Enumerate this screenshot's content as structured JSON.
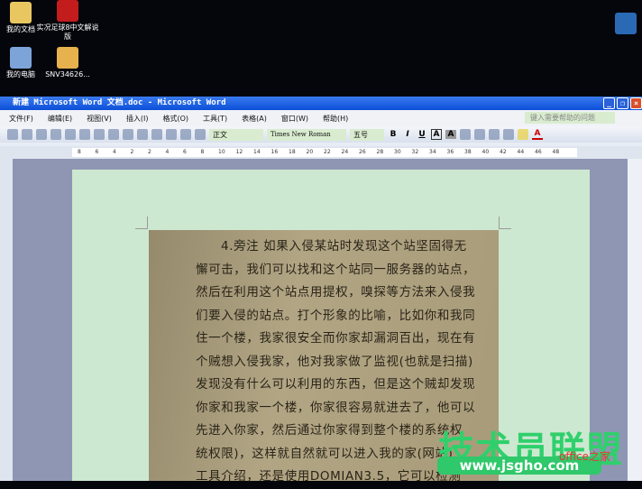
{
  "desktop": {
    "icons": [
      {
        "label": "我的文档"
      },
      {
        "label": "实况足球8中文解说版"
      },
      {
        "label": "我的电脑"
      },
      {
        "label": "SNV34626..."
      }
    ]
  },
  "window": {
    "title": "新建 Microsoft Word 文档.doc - Microsoft Word"
  },
  "menu": [
    "文件(F)",
    "编辑(E)",
    "视图(V)",
    "插入(I)",
    "格式(O)",
    "工具(T)",
    "表格(A)",
    "窗口(W)",
    "帮助(H)"
  ],
  "help_placeholder": "键入需要帮助的问题",
  "toolbar": {
    "style": "正文",
    "font": "Times New Roman",
    "size": "五号",
    "bold": "B",
    "italic": "I",
    "underline": "U",
    "charbox": "A",
    "shade": "A",
    "fontcolor": "A"
  },
  "ruler": [
    "8",
    "6",
    "4",
    "2",
    "2",
    "4",
    "6",
    "8",
    "10",
    "12",
    "14",
    "16",
    "18",
    "20",
    "22",
    "24",
    "26",
    "28",
    "30",
    "32",
    "34",
    "36",
    "38",
    "40",
    "42",
    "44",
    "46",
    "48"
  ],
  "document": {
    "lines": [
      "4.旁注 如果入侵某站时发现这个站坚固得无",
      "懈可击，我们可以找和这个站同一服务器的站点，",
      "然后在利用这个站点用提权，嗅探等方法来入侵我",
      "们要入侵的站点。打个形象的比喻，比如你和我同",
      "住一个楼，我家很安全而你家却漏洞百出，现在有",
      "个贼想入侵我家，他对我家做了监视(也就是扫描)",
      "发现没有什么可以利用的东西，但是这个贼却发现",
      "你家和我家一个楼，你家很容易就进去了，他可以",
      "先进入你家，然后通过你家得到整个楼的系统权",
      "统权限)，这样就自然就可以进入我的家(网站)",
      "    工具介绍，还是使用DOMIAN3.5，它可以检测"
    ]
  },
  "watermark": {
    "brand": "技术员联盟",
    "url": "www.jsgho.com",
    "office": "office之家"
  }
}
